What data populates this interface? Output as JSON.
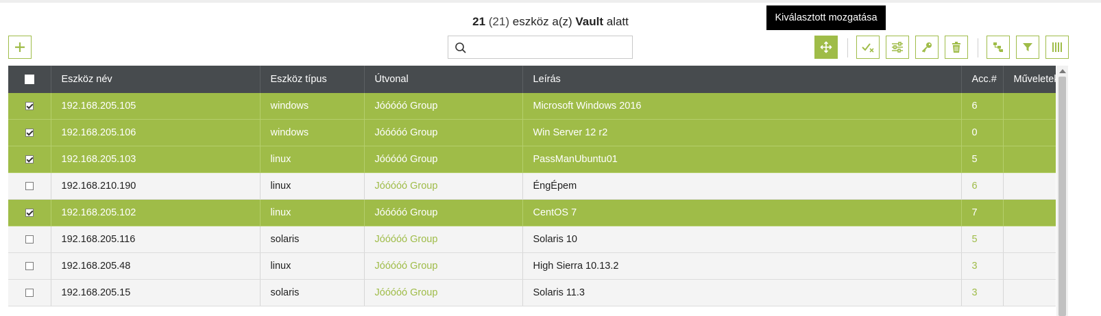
{
  "header": {
    "count": "21",
    "total": "(21)",
    "middle_text": "eszköz a(z)",
    "vault_name": "Vault",
    "suffix": "alatt"
  },
  "tooltip": "Kiválasztott mozgatása",
  "search": {
    "placeholder": "",
    "value": ""
  },
  "toolbar": {
    "icons": [
      "plus-icon",
      "move-icon",
      "deselect-icon",
      "sliders-icon",
      "key-icon",
      "trash-icon",
      "tree-icon",
      "filter-icon",
      "columns-icon"
    ],
    "accent_color": "#9fbc48"
  },
  "table": {
    "columns": [
      "Eszköz név",
      "Eszköz típus",
      "Útvonal",
      "Leírás",
      "Acc.#",
      "Műveletek"
    ],
    "rows": [
      {
        "selected": true,
        "name": "192.168.205.105",
        "type": "windows",
        "path": "Jóóóóó Group",
        "desc": "Microsoft Windows 2016",
        "acc": "6"
      },
      {
        "selected": true,
        "name": "192.168.205.106",
        "type": "windows",
        "path": "Jóóóóó Group",
        "desc": "Win Server 12 r2",
        "acc": "0"
      },
      {
        "selected": true,
        "name": "192.168.205.103",
        "type": "linux",
        "path": "Jóóóóó Group",
        "desc": "PassManUbuntu01",
        "acc": "5"
      },
      {
        "selected": false,
        "name": "192.168.210.190",
        "type": "linux",
        "path": "Jóóóóó Group",
        "desc": "ÉngÉpem",
        "acc": "6"
      },
      {
        "selected": true,
        "name": "192.168.205.102",
        "type": "linux",
        "path": "Jóóóóó Group",
        "desc": "CentOS 7",
        "acc": "7"
      },
      {
        "selected": false,
        "name": "192.168.205.116",
        "type": "solaris",
        "path": "Jóóóóó Group",
        "desc": "Solaris 10",
        "acc": "5"
      },
      {
        "selected": false,
        "name": "192.168.205.48",
        "type": "linux",
        "path": "Jóóóóó Group",
        "desc": "High Sierra 10.13.2",
        "acc": "3"
      },
      {
        "selected": false,
        "name": "192.168.205.15",
        "type": "solaris",
        "path": "Jóóóóó Group",
        "desc": "Solaris 11.3",
        "acc": "3"
      }
    ]
  }
}
